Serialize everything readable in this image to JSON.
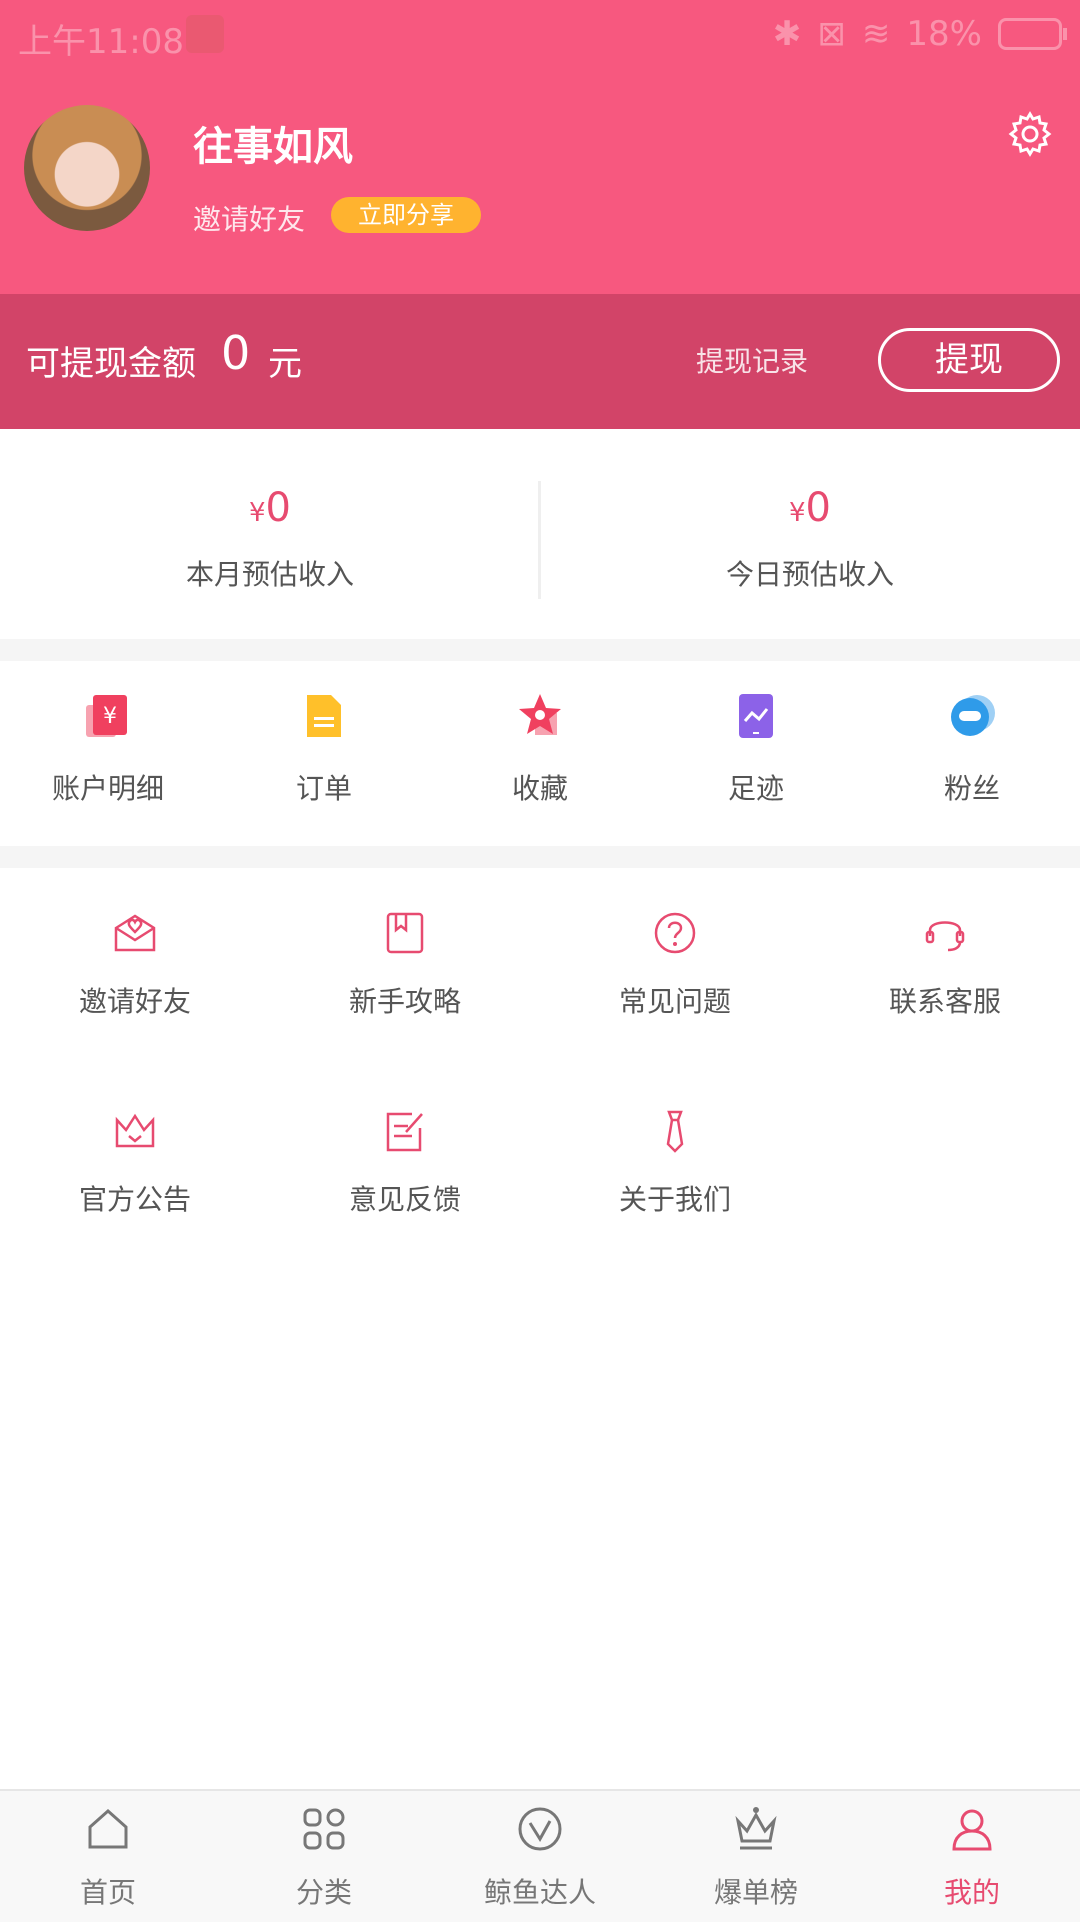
{
  "status_bar": {
    "time": "上午11:08",
    "battery": "18%"
  },
  "profile": {
    "username": "往事如风",
    "invite_label": "邀请好友",
    "share_button": "立即分享"
  },
  "balance": {
    "label": "可提现金额",
    "amount": "0",
    "unit": "元",
    "record_link": "提现记录",
    "withdraw_button": "提现"
  },
  "income": [
    {
      "value": "0",
      "currency": "¥",
      "label": "本月预估收入"
    },
    {
      "value": "0",
      "currency": "¥",
      "label": "今日预估收入"
    }
  ],
  "quick_actions": [
    {
      "label": "账户明细",
      "icon": "account-detail-icon",
      "color": "#f0405f"
    },
    {
      "label": "订单",
      "icon": "order-icon",
      "color": "#ffc02a"
    },
    {
      "label": "收藏",
      "icon": "favorite-icon",
      "color": "#f0405f"
    },
    {
      "label": "足迹",
      "icon": "footprint-icon",
      "color": "#8c62e8"
    },
    {
      "label": "粉丝",
      "icon": "fans-icon",
      "color": "#2f9be9"
    }
  ],
  "service_grid": [
    {
      "label": "邀请好友",
      "icon": "invite-friends-icon"
    },
    {
      "label": "新手攻略",
      "icon": "guide-book-icon"
    },
    {
      "label": "常见问题",
      "icon": "faq-icon"
    },
    {
      "label": "联系客服",
      "icon": "customer-service-icon"
    },
    {
      "label": "官方公告",
      "icon": "announcement-crown-icon"
    },
    {
      "label": "意见反馈",
      "icon": "feedback-icon"
    },
    {
      "label": "关于我们",
      "icon": "about-us-icon"
    }
  ],
  "bottom_nav": [
    {
      "label": "首页",
      "icon": "home-icon",
      "active": false
    },
    {
      "label": "分类",
      "icon": "category-icon",
      "active": false
    },
    {
      "label": "鲸鱼达人",
      "icon": "whale-expert-icon",
      "active": false
    },
    {
      "label": "爆单榜",
      "icon": "ranking-crown-icon",
      "active": false
    },
    {
      "label": "我的",
      "icon": "profile-icon",
      "active": true
    }
  ],
  "colors": {
    "brand_pink": "#f7587f",
    "balance_bar": "#d24468",
    "accent": "#e74b70"
  }
}
